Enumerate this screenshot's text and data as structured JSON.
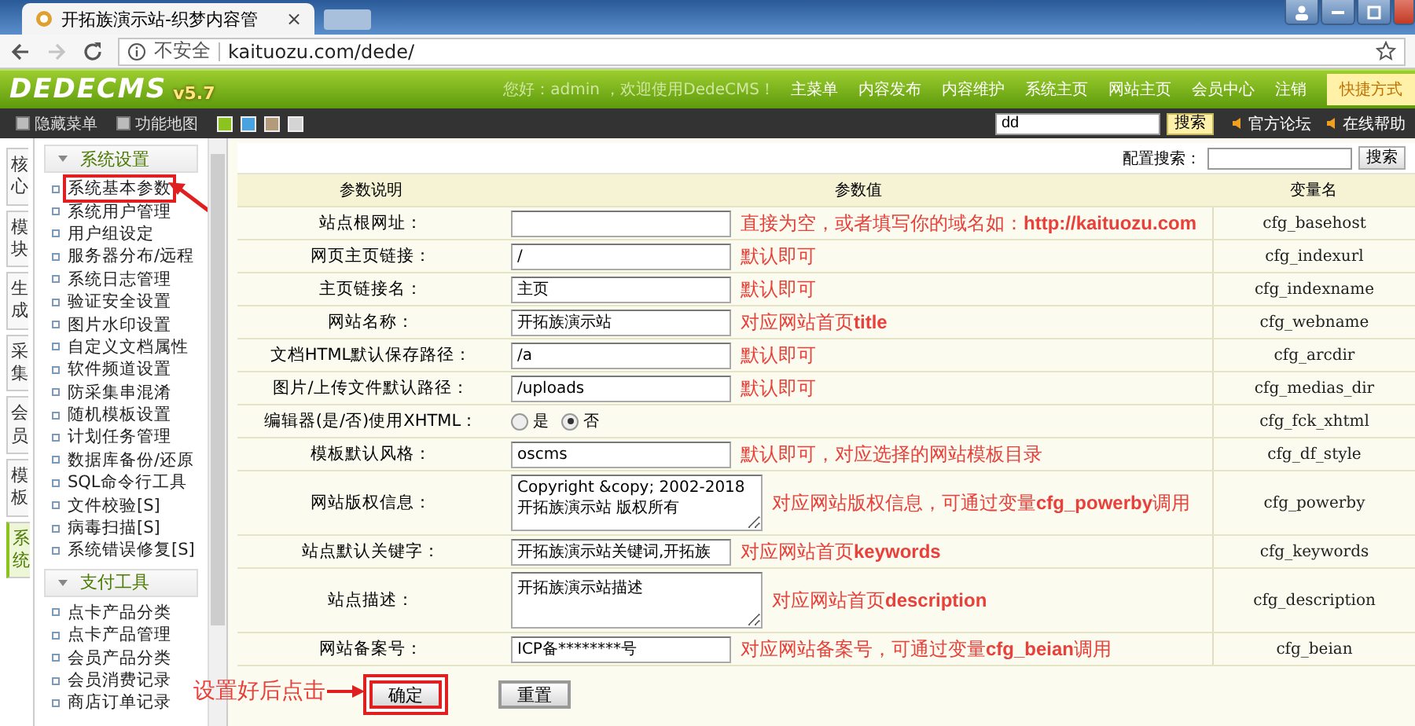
{
  "browser": {
    "tab_title": "开拓族演示站-织梦内容管",
    "tab_close": "×",
    "security": "不安全",
    "url": "kaituozu.com/dede/"
  },
  "header": {
    "logo": "DEDECMS",
    "version": "v5.7",
    "greeting": "您好：admin ，欢迎使用DedeCMS！",
    "nav": [
      "主菜单",
      "内容发布",
      "内容维护",
      "系统主页",
      "网站主页",
      "会员中心",
      "注销"
    ],
    "quick": "快捷方式"
  },
  "toolbar": {
    "items": [
      "隐藏菜单",
      "功能地图"
    ],
    "swatches": [
      {
        "color": "#8ec31f"
      },
      {
        "color": "#4aa3df"
      },
      {
        "color": "#b39a7a"
      },
      {
        "color": "#d4d4d4"
      }
    ],
    "search": {
      "value": "dd",
      "button": "搜索"
    },
    "links": [
      "官方论坛",
      "在线帮助"
    ]
  },
  "side_tabs": [
    {
      "label": "核心",
      "selected": false
    },
    {
      "label": "模块",
      "selected": false
    },
    {
      "label": "生成",
      "selected": false
    },
    {
      "label": "采集",
      "selected": false
    },
    {
      "label": "会员",
      "selected": false
    },
    {
      "label": "模板",
      "selected": false
    },
    {
      "label": "系统",
      "selected": true
    }
  ],
  "sidebar": [
    {
      "title": "系统设置",
      "items": [
        {
          "label": "系统基本参数",
          "marked": true
        },
        {
          "label": "系统用户管理",
          "marked": false
        },
        {
          "label": "用户组设定",
          "marked": false
        },
        {
          "label": "服务器分布/远程",
          "marked": false
        },
        {
          "label": "系统日志管理",
          "marked": false
        },
        {
          "label": "验证安全设置",
          "marked": false
        },
        {
          "label": "图片水印设置",
          "marked": false
        },
        {
          "label": "自定义文档属性",
          "marked": false
        },
        {
          "label": "软件频道设置",
          "marked": false
        },
        {
          "label": "防采集串混淆",
          "marked": false
        },
        {
          "label": "随机模板设置",
          "marked": false
        },
        {
          "label": "计划任务管理",
          "marked": false
        },
        {
          "label": "数据库备份/还原",
          "marked": false
        },
        {
          "label": "SQL命令行工具",
          "marked": false
        },
        {
          "label": "文件校验[S]",
          "marked": false
        },
        {
          "label": "病毒扫描[S]",
          "marked": false
        },
        {
          "label": "系统错误修复[S]",
          "marked": false
        }
      ]
    },
    {
      "title": "支付工具",
      "items": [
        {
          "label": "点卡产品分类",
          "marked": false
        },
        {
          "label": "点卡产品管理",
          "marked": false
        },
        {
          "label": "会员产品分类",
          "marked": false
        },
        {
          "label": "会员消费记录",
          "marked": false
        },
        {
          "label": "商店订单记录",
          "marked": false
        }
      ]
    }
  ],
  "config_search": {
    "label": "配置搜索：",
    "button": "搜索"
  },
  "table": {
    "columns": [
      "参数说明",
      "参数值",
      "变量名"
    ],
    "rows": [
      {
        "kind": "text",
        "label": "站点根网址：",
        "note": "直接为空，或者填写你的域名如：**http://kaituozu.com**",
        "var": "cfg_basehost"
      },
      {
        "kind": "text",
        "label": "网页主页链接：",
        "value": "/",
        "note": "默认即可",
        "var": "cfg_indexurl"
      },
      {
        "kind": "text",
        "label": "主页链接名：",
        "value": "主页",
        "note": "默认即可",
        "var": "cfg_indexname"
      },
      {
        "kind": "text",
        "label": "网站名称：",
        "value": "开拓族演示站",
        "note": "对应网站首页**title**",
        "var": "cfg_webname"
      },
      {
        "kind": "text",
        "label": "文档HTML默认保存路径：",
        "value": "/a",
        "note": "默认即可",
        "var": "cfg_arcdir"
      },
      {
        "kind": "text",
        "label": "图片/上传文件默认路径：",
        "value": "/uploads",
        "note": "默认即可",
        "var": "cfg_medias_dir"
      },
      {
        "kind": "radio",
        "label": "编辑器(是/否)使用XHTML：",
        "options": [
          {
            "label": "是",
            "selected": false
          },
          {
            "label": "否",
            "selected": true
          }
        ],
        "var": "cfg_fck_xhtml"
      },
      {
        "kind": "text",
        "label": "模板默认风格：",
        "value": "oscms",
        "note": "默认即可，对应选择的网站模板目录",
        "var": "cfg_df_style"
      },
      {
        "kind": "textarea",
        "label": "网站版权信息：",
        "value": "Copyright &copy; 2002-2018 开拓族演示站 版权所有",
        "note": "对应网站版权信息，可通过变量**cfg_powerby**调用",
        "var": "cfg_powerby"
      },
      {
        "kind": "text",
        "label": "站点默认关键字：",
        "value": "开拓族演示站关键词,开拓族",
        "note": "对应网站首页**keywords**",
        "var": "cfg_keywords"
      },
      {
        "kind": "textarea",
        "label": "站点描述：",
        "value": "开拓族演示站描述",
        "note": "对应网站首页**description**",
        "var": "cfg_description"
      },
      {
        "kind": "text",
        "label": "网站备案号：",
        "value": "ICP备********号",
        "note": "对应网站备案号，可通过变量**cfg_beian**调用",
        "var": "cfg_beian"
      }
    ]
  },
  "footer": {
    "note": "设置好后点击",
    "buttons": [
      {
        "label": "确定",
        "marked": true
      },
      {
        "label": "重置",
        "marked": false
      }
    ]
  }
}
